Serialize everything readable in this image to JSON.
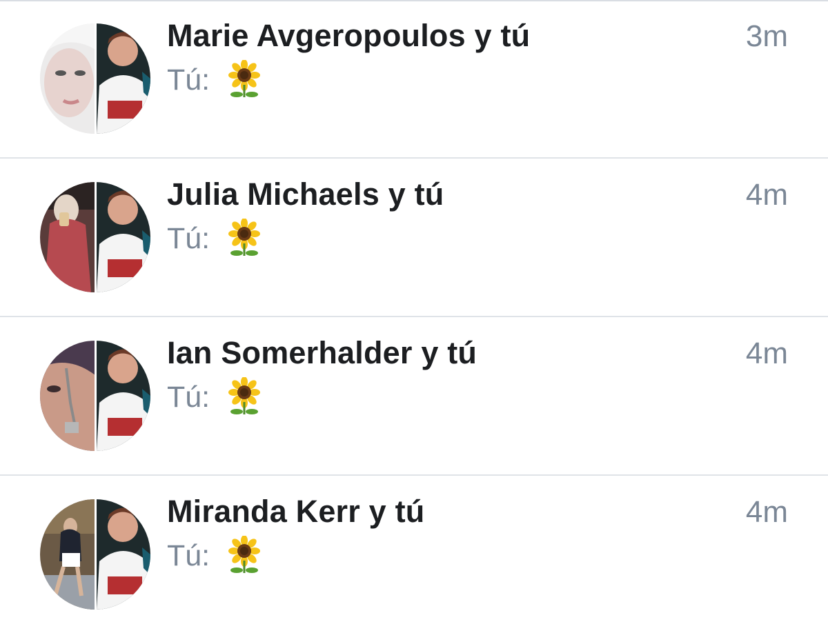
{
  "conversations": [
    {
      "title": "Marie Avgeropoulos y tú",
      "time": "3m",
      "preview_label": "Tú:",
      "preview_icon": "sunflower-emoji"
    },
    {
      "title": "Julia Michaels y tú",
      "time": "4m",
      "preview_label": "Tú:",
      "preview_icon": "sunflower-emoji"
    },
    {
      "title": "Ian Somerhalder y tú",
      "time": "4m",
      "preview_label": "Tú:",
      "preview_icon": "sunflower-emoji"
    },
    {
      "title": "Miranda Kerr y tú",
      "time": "4m",
      "preview_label": "Tú:",
      "preview_icon": "sunflower-emoji"
    }
  ],
  "colors": {
    "title": "#1c1e21",
    "secondary_text": "#7b8796",
    "divider": "#dfe3e8"
  }
}
